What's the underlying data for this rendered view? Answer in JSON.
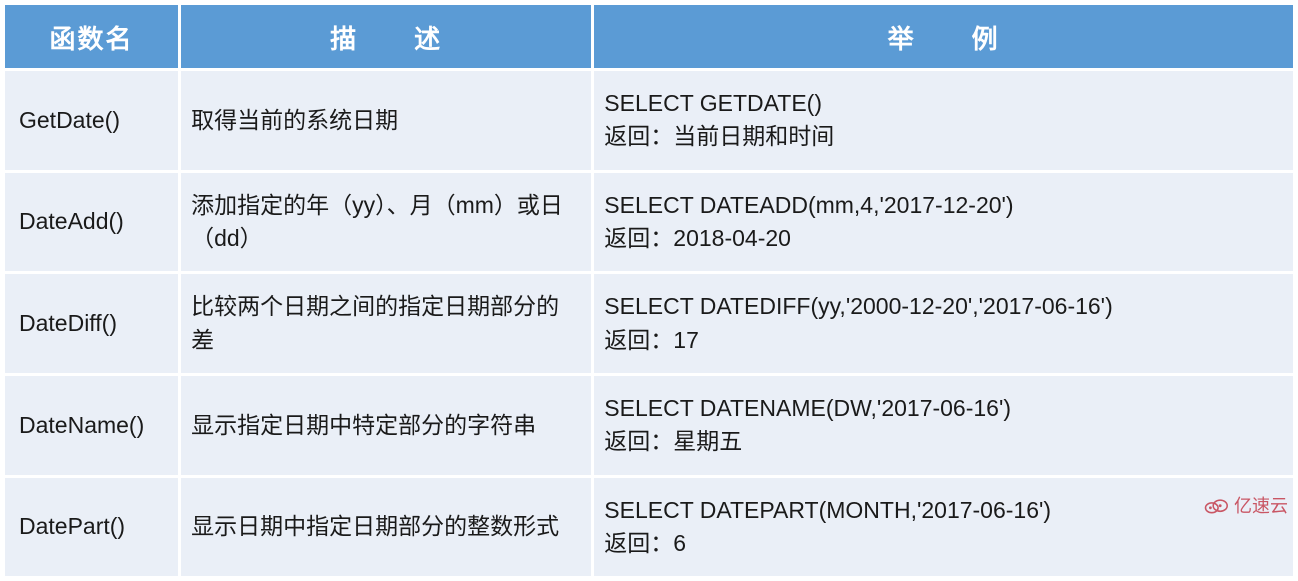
{
  "table": {
    "headers": [
      "函数名",
      "描　　述",
      "举　　例"
    ],
    "rows": [
      {
        "fn": "GetDate()",
        "desc": "取得当前的系统日期",
        "example": "SELECT GETDATE()\n返回：当前日期和时间"
      },
      {
        "fn": "DateAdd()",
        "desc": "添加指定的年（yy）、月（mm）或日（dd）",
        "example": "SELECT DATEADD(mm,4,'2017-12-20')\n返回：2018-04-20"
      },
      {
        "fn": "DateDiff()",
        "desc": "比较两个日期之间的指定日期部分的差",
        "example": "SELECT DATEDIFF(yy,'2000-12-20','2017-06-16')\n返回：17"
      },
      {
        "fn": "DateName()",
        "desc": "显示指定日期中特定部分的字符串",
        "example": "SELECT DATENAME(DW,'2017-06-16')\n返回：星期五"
      },
      {
        "fn": "DatePart()",
        "desc": "显示日期中指定日期部分的整数形式",
        "example": "SELECT DATEPART(MONTH,'2017-06-16')\n返回：6"
      }
    ]
  },
  "watermark_text": "亿速云"
}
